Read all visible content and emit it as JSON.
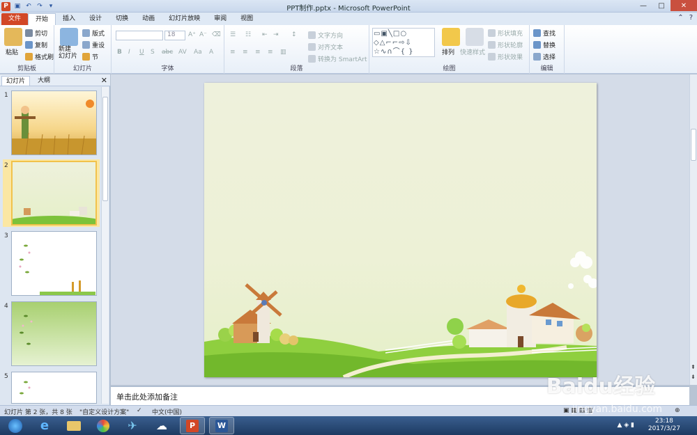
{
  "window": {
    "title": "PPT制作.pptx - Microsoft PowerPoint",
    "app_logo": "P",
    "controls": {
      "minimize": "—",
      "maximize": "□",
      "close": "✕"
    }
  },
  "tabs": [
    "文件",
    "开始",
    "插入",
    "设计",
    "切换",
    "动画",
    "幻灯片放映",
    "审阅",
    "视图"
  ],
  "active_tab": "开始",
  "ribbon": {
    "clipboard": {
      "label": "剪贴板",
      "paste": "粘贴",
      "cut": "剪切",
      "copy": "复制",
      "format_painter": "格式刷"
    },
    "slides": {
      "label": "幻灯片",
      "new_slide": "新建\n幻灯片",
      "layout": "版式",
      "reset": "重设",
      "section": "节"
    },
    "font": {
      "label": "字体",
      "font_name": "",
      "font_size": "18"
    },
    "paragraph": {
      "label": "段落",
      "text_direction": "文字方向",
      "align_text": "对齐文本",
      "smartart": "转换为 SmartArt"
    },
    "drawing": {
      "label": "绘图",
      "arrange": "排列",
      "quick_styles": "快速样式",
      "shape_fill": "形状填充",
      "shape_outline": "形状轮廓",
      "shape_effects": "形状效果"
    },
    "editing": {
      "label": "编辑",
      "find": "查找",
      "replace": "替换",
      "select": "选择"
    }
  },
  "slide_pane": {
    "tabs": [
      "幻灯片",
      "大纲"
    ],
    "slides": [
      "1",
      "2",
      "3",
      "4",
      "5"
    ],
    "selected": 2
  },
  "notes_placeholder": "单击此处添加备注",
  "status": {
    "slide_info": "幻灯片 第 2 张，共 8 张",
    "theme": "\"自定义设计方案\"",
    "language": "中文(中国)"
  },
  "taskbar": {
    "time": "23:18",
    "date": "2017/3/27"
  },
  "watermark": {
    "brand": "Baidu经验",
    "url": "jingyan.baidu.com"
  },
  "colors": {
    "accent": "#d24726",
    "ribbon": "#dfe9f5",
    "selection": "#f1c24b"
  }
}
